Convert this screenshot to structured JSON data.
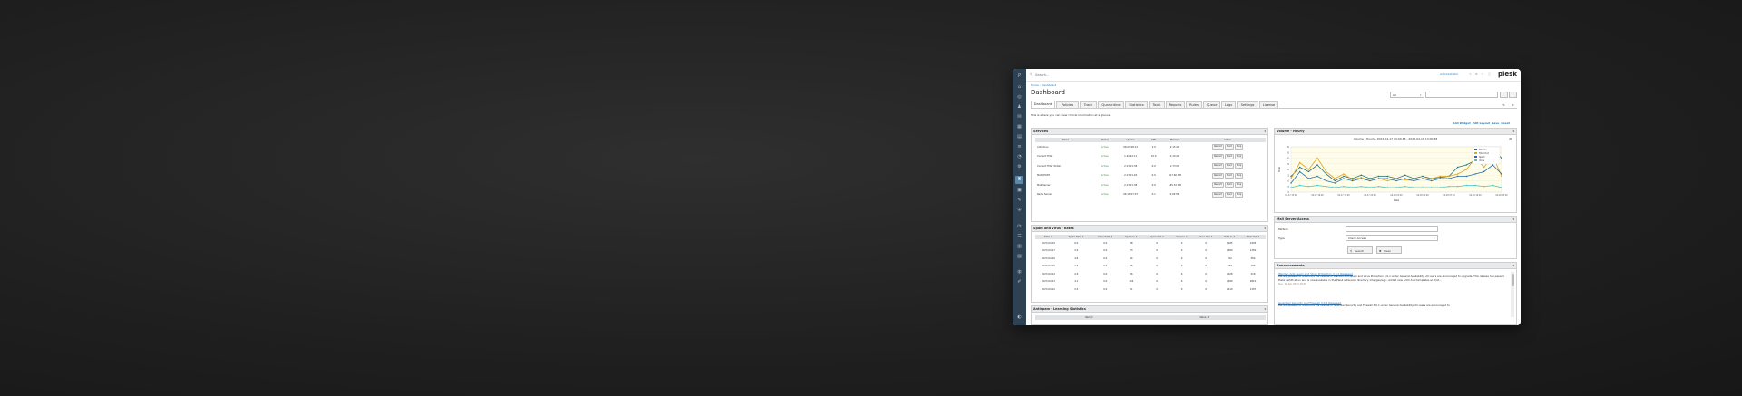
{
  "header": {
    "search_placeholder": "Search...",
    "user": "Administrator",
    "brand": "plesk"
  },
  "breadcrumb": [
    "Home",
    "Dashboard"
  ],
  "page": {
    "title": "Dashboard",
    "description": "This is where you can view critical information at a glance."
  },
  "filter": {
    "select_value": "All",
    "input_value": ""
  },
  "tabs": [
    "Dashboard",
    "Policies",
    "Track",
    "Quarantine",
    "Statistics",
    "Tools",
    "Reports",
    "Rules",
    "Queue",
    "Logs",
    "Settings",
    "License"
  ],
  "widget_actions": [
    "Add Widget",
    "Edit Layout",
    "Save",
    "Reset"
  ],
  "services": {
    "title": "Services",
    "columns": [
      "Name",
      "Status",
      "Uptime",
      "CPU",
      "Memory",
      "Action"
    ],
    "rows": [
      {
        "name": "Anti-Virus",
        "status": "Active",
        "uptime": "06:07:08:12",
        "cpu": "2.0",
        "memory": "2.15 GB"
      },
      {
        "name": "Content Filter",
        "status": "Active",
        "uptime": "1:22:42:11",
        "cpu": "10.9",
        "memory": "2.19 GB"
      },
      {
        "name": "Content Filter Writer",
        "status": "Active",
        "uptime": "2:13:21:38",
        "cpu": "0.0",
        "memory": "2.73 KB"
      },
      {
        "name": "MAPI/POP3",
        "status": "Active",
        "uptime": "2:13:21:40",
        "cpu": "0.0",
        "memory": "417.60 MB"
      },
      {
        "name": "Mail Server",
        "status": "Active",
        "uptime": "2:13:21:38",
        "cpu": "0.0",
        "memory": "185.32 MB"
      },
      {
        "name": "Redis Server",
        "status": "Active",
        "uptime": "06:18:07:07",
        "cpu": "0.1",
        "memory": "9.09 MB"
      }
    ],
    "actions": [
      "Restart",
      "Start",
      "Stop"
    ]
  },
  "rates": {
    "title": "Spam and Virus - Rates",
    "columns": [
      "Date",
      "Spam Rate",
      "Virus Rate",
      "Spam In",
      "Spam Out",
      "Virus In",
      "Virus Out",
      "Total In",
      "Total Out"
    ],
    "rows": [
      [
        "2023-04-19",
        "6.0",
        "0.0",
        "38",
        "0",
        "0",
        "0",
        "1185",
        "2405"
      ],
      [
        "2023-04-17",
        "2.9",
        "0.0",
        "73",
        "0",
        "0",
        "0",
        "2480",
        "1350"
      ],
      [
        "2023-04-16",
        "4.6",
        "0.0",
        "44",
        "0",
        "0",
        "0",
        "952",
        "384"
      ],
      [
        "2023-04-15",
        "2.9",
        "0.0",
        "56",
        "0",
        "0",
        "0",
        "784",
        "186"
      ],
      [
        "2023-04-14",
        "2.6",
        "0.0",
        "56",
        "0",
        "0",
        "0",
        "2028",
        "418"
      ],
      [
        "2023-04-13",
        "4.1",
        "0.0",
        "104",
        "0",
        "0",
        "0",
        "2480",
        "2810"
      ],
      [
        "2023-04-12",
        "2.5",
        "0.0",
        "51",
        "0",
        "0",
        "0",
        "2010",
        "1307"
      ]
    ]
  },
  "antispam": {
    "title": "Antispam - Learning Statistics",
    "columns": [
      "Item",
      "Value"
    ]
  },
  "volume": {
    "title": "Volume - Hourly",
    "chart_data": {
      "type": "line",
      "title": "Volume - Hourly, 2023-04-17 13:00:48 - 2023-04-18 13:00:48",
      "xlabel": "Date",
      "ylabel": "Total",
      "ylim": [
        0,
        40
      ],
      "yticks": [
        0,
        5,
        10,
        15,
        20,
        25,
        30,
        35,
        40
      ],
      "x": [
        0,
        1,
        2,
        3,
        4,
        5,
        6,
        7,
        8,
        9,
        10,
        11,
        12,
        13,
        14,
        15,
        16,
        17,
        18,
        19,
        20,
        21,
        22,
        23,
        24
      ],
      "xtick_labels": [
        "04-17 13:00",
        "04-17 16:00",
        "04-17 19:00",
        "04-17 22:00",
        "04-18 01:00",
        "04-18 04:00",
        "04-18 07:00",
        "04-18 10:00",
        "04-18 13:00"
      ],
      "series": [
        {
          "name": "Total In",
          "color": "#2a6f73",
          "values": [
            14,
            22,
            18,
            24,
            16,
            10,
            14,
            12,
            15,
            12,
            14,
            14,
            12,
            15,
            12,
            14,
            12,
            13,
            14,
            22,
            24,
            28,
            34,
            38,
            30
          ]
        },
        {
          "name": "Total Out",
          "color": "#e3a21a",
          "values": [
            12,
            26,
            20,
            30,
            18,
            12,
            16,
            11,
            13,
            10,
            12,
            10,
            12,
            11,
            10,
            12,
            12,
            14,
            14,
            16,
            20,
            30,
            22,
            32,
            14
          ]
        },
        {
          "name": "Spam",
          "color": "#1f6fb2",
          "values": [
            8,
            18,
            12,
            14,
            10,
            8,
            12,
            10,
            12,
            10,
            12,
            12,
            10,
            12,
            10,
            12,
            10,
            12,
            12,
            14,
            14,
            16,
            18,
            24,
            16
          ]
        },
        {
          "name": "Virus",
          "color": "#4dc3c9",
          "values": [
            4,
            6,
            5,
            6,
            5,
            4,
            5,
            4,
            5,
            4,
            5,
            4,
            4,
            5,
            4,
            4,
            4,
            4,
            5,
            5,
            6,
            6,
            5,
            6,
            4
          ]
        }
      ]
    }
  },
  "mail_access": {
    "title": "Mail Server Access",
    "pattern_label": "Pattern",
    "type_label": "Type",
    "type_value": "Client Access",
    "search_button": "Search",
    "clear_button": "Clear"
  },
  "announcements": {
    "title": "Announcements",
    "items": [
      {
        "title": "Warden Anti-spam and Virus Protection 3.0.x Released",
        "body": "We are pleased to announce the release of Warden Anti-spam and Virus Protection 3.0.x under General Availability. All users are encouraged to upgrade. This release has passed Plesk certification and is now available in the Plesk extension directory. Changes(eg):- Added new h.tml.tuhl templates so that...",
        "date": "Sun, 16 Apr 2023 18:39"
      },
      {
        "title": "Guardian Security and Firewall 3.0.1 Released",
        "body": "We are pleased to announce the release of Guardian Security and Firewall 3.0.1 under General Availability. All users are encouraged to",
        "date": ""
      }
    ]
  }
}
